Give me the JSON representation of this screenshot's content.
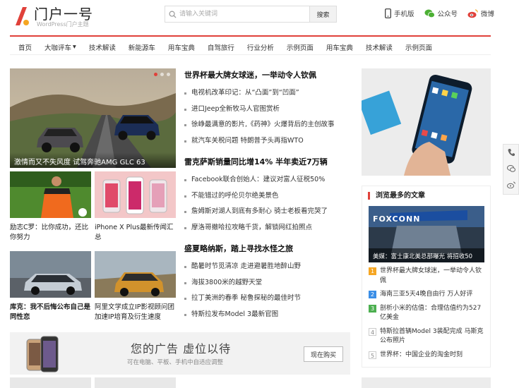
{
  "brand": {
    "title": "门户一号",
    "subtitle": "WordPress门户主题",
    "accent": "#e0413a"
  },
  "search": {
    "placeholder": "请输入关键词",
    "button": "搜索"
  },
  "header_links": [
    {
      "label": "手机版",
      "icon": "phone-icon"
    },
    {
      "label": "公众号",
      "icon": "wechat-icon"
    },
    {
      "label": "微博",
      "icon": "weibo-icon"
    }
  ],
  "nav": [
    "首页",
    "大咖评车",
    "技术解读",
    "新能源车",
    "用车宝典",
    "自驾旅行",
    "行业分析",
    "示例页面",
    "用车宝典",
    "技术解读",
    "示例页面"
  ],
  "hero": {
    "caption": "激情而又不失风度 试驾奔驰AMG GLC 63"
  },
  "thumbs": [
    "励志C罗：比你成功，还比你努力",
    "iPhone X Plus最新传闻汇总",
    "库克：我不后悔公布自己是同性恋",
    "阿里文学成立IP影视顾问团 加速IP培育及衍生速度"
  ],
  "news_groups": [
    {
      "lead": "世界杯最大牌女球迷，一举动令人钦佩",
      "items": [
        "电视机改革印记：从“凸面”到“凹面”",
        "进口Jeep全新牧马人官图赏析",
        "徐峥最满意的影片,《药神》火爆背后的主创故事",
        "就汽车关税问题 特朗普予头再指WTO"
      ]
    },
    {
      "lead": "雷克萨斯销量同比增14% 半年卖近7万辆",
      "items": [
        "Facebook联合创始人：建议对富人征税50%",
        "不能错过的呼伦贝尔绝美景色",
        "詹姆斯对湖人到底有多耐心 骑士老板看完哭了",
        "摩洛哥撤哈拉攻略千货，解锁网红拍照点"
      ]
    },
    {
      "lead": "盛夏略纳斯，踏上寻找水怪之旅",
      "items": [
        "酷暑时节觅清凉 走进避暑胜地醉山野",
        "海拔3800米的越野天堂",
        "拉丁美洲的春季 秘鲁探秘的最佳时节",
        "特斯拉发布Model 3最新官图"
      ]
    }
  ],
  "ad": {
    "title": "您的广告 虚位以待",
    "subtitle": "可在电脑、平板、手机中自适应调整",
    "button": "现在购买"
  },
  "popular": {
    "title": "浏览最多的文章",
    "image_caption": "美媒：富士康北美总部曝光 将招收50",
    "items": [
      {
        "rank": "1",
        "text": "世界杯最大牌女球迷，一举动令人钦佩",
        "color": "#f5a623"
      },
      {
        "rank": "2",
        "text": "海南三亚5天4晚自由行 万人好评",
        "color": "#3a8ee6"
      },
      {
        "rank": "3",
        "text": "剖析小米的估值：合理估值约为527亿美金",
        "color": "#4caf50"
      },
      {
        "rank": "4",
        "text": "特斯拉首辆Model 3装配完成 马斯克公布照片",
        "color": "#999999"
      },
      {
        "rank": "5",
        "text": "世界杯：中国企业的淘金时刻",
        "color": "#999999"
      }
    ]
  }
}
